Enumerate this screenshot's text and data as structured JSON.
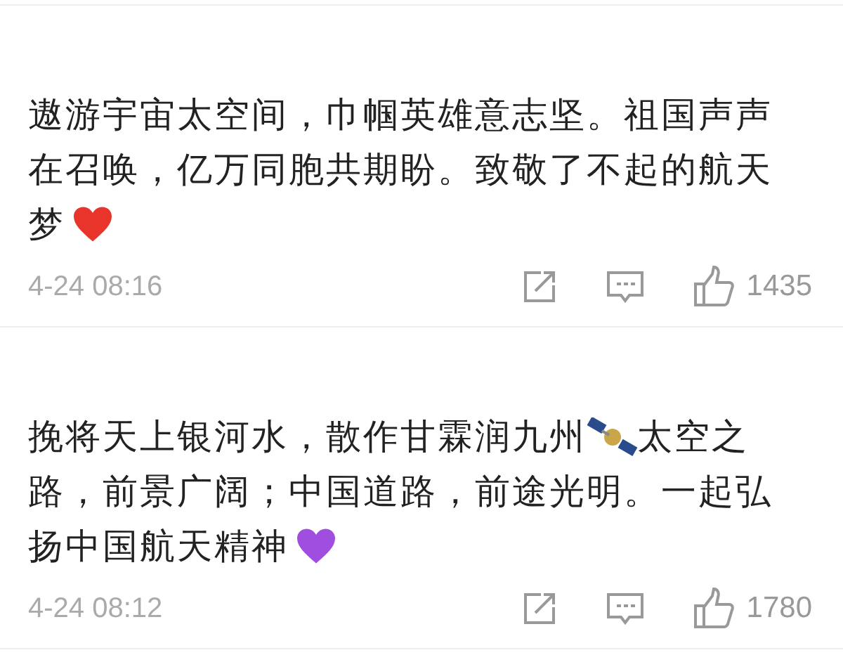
{
  "comments": [
    {
      "lines": [
        [
          {
            "kind": "text",
            "text": "遨游宇宙太空间，巾帼英雄意志坚。祖国声声"
          }
        ],
        [
          {
            "kind": "text",
            "text": "在召唤，亿万同胞共期盼。致敬了不起的航天"
          }
        ],
        [
          {
            "kind": "text",
            "text": "梦"
          },
          {
            "kind": "red_heart"
          }
        ]
      ],
      "time": "4-24 08:16",
      "likes": "1435"
    },
    {
      "lines": [
        [
          {
            "kind": "text",
            "text": "挽将天上银河水，散作甘霖润九州"
          },
          {
            "kind": "satellite"
          },
          {
            "kind": "text",
            "text": "太空之"
          }
        ],
        [
          {
            "kind": "text",
            "text": "路，前景广阔；中国道路，前途光明。一起弘"
          }
        ],
        [
          {
            "kind": "text",
            "text": "扬中国航天精神"
          },
          {
            "kind": "purple_heart"
          }
        ]
      ],
      "time": "4-24 08:12",
      "likes": "1780"
    }
  ]
}
